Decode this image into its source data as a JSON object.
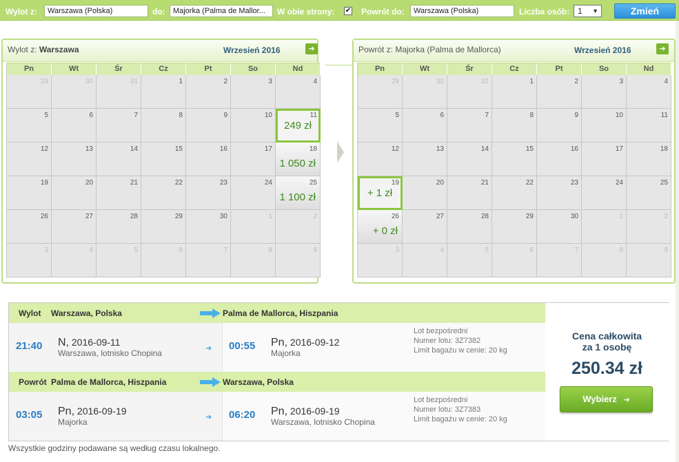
{
  "search": {
    "from_label": "Wylot z:",
    "from_value": "Warszawa (Polska)",
    "to_label": "do:",
    "to_value": "Majorka (Palma de Mallor...",
    "roundtrip_label": "W obie strony:",
    "roundtrip_checked": "✔",
    "return_label": "Powrót do:",
    "return_value": "Warszawa (Polska)",
    "persons_label": "Liczba osób:",
    "persons_value": "1",
    "submit_label": "Zmień"
  },
  "weekdays": [
    "Pn",
    "Wt",
    "Śr",
    "Cz",
    "Pt",
    "So",
    "Nd"
  ],
  "outbound_calendar": {
    "title_prefix": "Wylot z:",
    "title_city": "Warszawa",
    "month": "Wrzesień 2016",
    "weeks": [
      [
        {
          "d": "29",
          "o": 1
        },
        {
          "d": "30",
          "o": 1
        },
        {
          "d": "31",
          "o": 1
        },
        {
          "d": "1"
        },
        {
          "d": "2"
        },
        {
          "d": "3"
        },
        {
          "d": "4"
        }
      ],
      [
        {
          "d": "5"
        },
        {
          "d": "6"
        },
        {
          "d": "7"
        },
        {
          "d": "8"
        },
        {
          "d": "9"
        },
        {
          "d": "10"
        },
        {
          "d": "11",
          "p": "249 zł",
          "s": 1
        }
      ],
      [
        {
          "d": "12"
        },
        {
          "d": "13"
        },
        {
          "d": "14"
        },
        {
          "d": "15"
        },
        {
          "d": "16"
        },
        {
          "d": "17"
        },
        {
          "d": "18",
          "p": "1 050 zł"
        }
      ],
      [
        {
          "d": "19"
        },
        {
          "d": "20"
        },
        {
          "d": "21"
        },
        {
          "d": "22"
        },
        {
          "d": "23"
        },
        {
          "d": "24"
        },
        {
          "d": "25",
          "p": "1 100 zł"
        }
      ],
      [
        {
          "d": "26"
        },
        {
          "d": "27"
        },
        {
          "d": "28"
        },
        {
          "d": "29"
        },
        {
          "d": "30"
        },
        {
          "d": "1",
          "o": 1
        },
        {
          "d": "2",
          "o": 1
        }
      ],
      [
        {
          "d": "3",
          "o": 1
        },
        {
          "d": "4",
          "o": 1
        },
        {
          "d": "5",
          "o": 1
        },
        {
          "d": "6",
          "o": 1
        },
        {
          "d": "7",
          "o": 1
        },
        {
          "d": "8",
          "o": 1
        },
        {
          "d": "9",
          "o": 1
        }
      ]
    ]
  },
  "return_calendar": {
    "title_prefix": "Powrót z:",
    "title_city": "Majorka (Palma de Mallorca)",
    "month": "Wrzesień 2016",
    "weeks": [
      [
        {
          "d": "29",
          "o": 1
        },
        {
          "d": "30",
          "o": 1
        },
        {
          "d": "31",
          "o": 1
        },
        {
          "d": "1"
        },
        {
          "d": "2"
        },
        {
          "d": "3"
        },
        {
          "d": "4"
        }
      ],
      [
        {
          "d": "5"
        },
        {
          "d": "6"
        },
        {
          "d": "7"
        },
        {
          "d": "8"
        },
        {
          "d": "9"
        },
        {
          "d": "10"
        },
        {
          "d": "11"
        }
      ],
      [
        {
          "d": "12"
        },
        {
          "d": "13"
        },
        {
          "d": "14"
        },
        {
          "d": "15"
        },
        {
          "d": "16"
        },
        {
          "d": "17"
        },
        {
          "d": "18"
        }
      ],
      [
        {
          "d": "19",
          "p": "+ 1 zł",
          "s": 1
        },
        {
          "d": "20"
        },
        {
          "d": "21"
        },
        {
          "d": "22"
        },
        {
          "d": "23"
        },
        {
          "d": "24"
        },
        {
          "d": "25"
        }
      ],
      [
        {
          "d": "26",
          "p": "+ 0 zł"
        },
        {
          "d": "27"
        },
        {
          "d": "28"
        },
        {
          "d": "29"
        },
        {
          "d": "30"
        },
        {
          "d": "1",
          "o": 1
        },
        {
          "d": "2",
          "o": 1
        }
      ],
      [
        {
          "d": "3",
          "o": 1
        },
        {
          "d": "4",
          "o": 1
        },
        {
          "d": "5",
          "o": 1
        },
        {
          "d": "6",
          "o": 1
        },
        {
          "d": "7",
          "o": 1
        },
        {
          "d": "8",
          "o": 1
        },
        {
          "d": "9",
          "o": 1
        }
      ]
    ]
  },
  "outbound": {
    "label": "Wylot",
    "from": "Warszawa, Polska",
    "to": "Palma de Mallorca, Hiszpania",
    "dep_time": "21:40",
    "dep_day": "N,",
    "dep_date": "2016-09-11",
    "dep_place": "Warszawa, lotnisko Chopina",
    "arr_time": "00:55",
    "arr_day": "Pn,",
    "arr_date": "2016-09-12",
    "arr_place": "Majorka",
    "info1": "Lot bezpośredni",
    "info2": "Numer lotu: 3Z7382",
    "info3": "Limit bagażu w cenie: 20 kg"
  },
  "return": {
    "label": "Powrót",
    "from": "Palma de Mallorca, Hiszpania",
    "to": "Warszawa, Polska",
    "dep_time": "03:05",
    "dep_day": "Pn,",
    "dep_date": "2016-09-19",
    "dep_place": "Majorka",
    "arr_time": "06:20",
    "arr_day": "Pn,",
    "arr_date": "2016-09-19",
    "arr_place": "Warszawa, lotnisko Chopina",
    "info1": "Lot bezpośredni",
    "info2": "Numer lotu: 3Z7383",
    "info3": "Limit bagażu w cenie: 20 kg"
  },
  "price": {
    "label_line1": "Cena całkowita",
    "label_line2": "za 1 osobę",
    "total": "250.34 zł",
    "select_label": "Wybierz"
  },
  "footnote": "Wszystkie godziny podawane są według czasu lokalnego.",
  "colors": {
    "accent_green": "#8cc63f",
    "header_green": "#b8dc72",
    "time_blue": "#2a7cc2",
    "price_green": "#3d8a1f",
    "button_blue": "#2b8fd8"
  }
}
